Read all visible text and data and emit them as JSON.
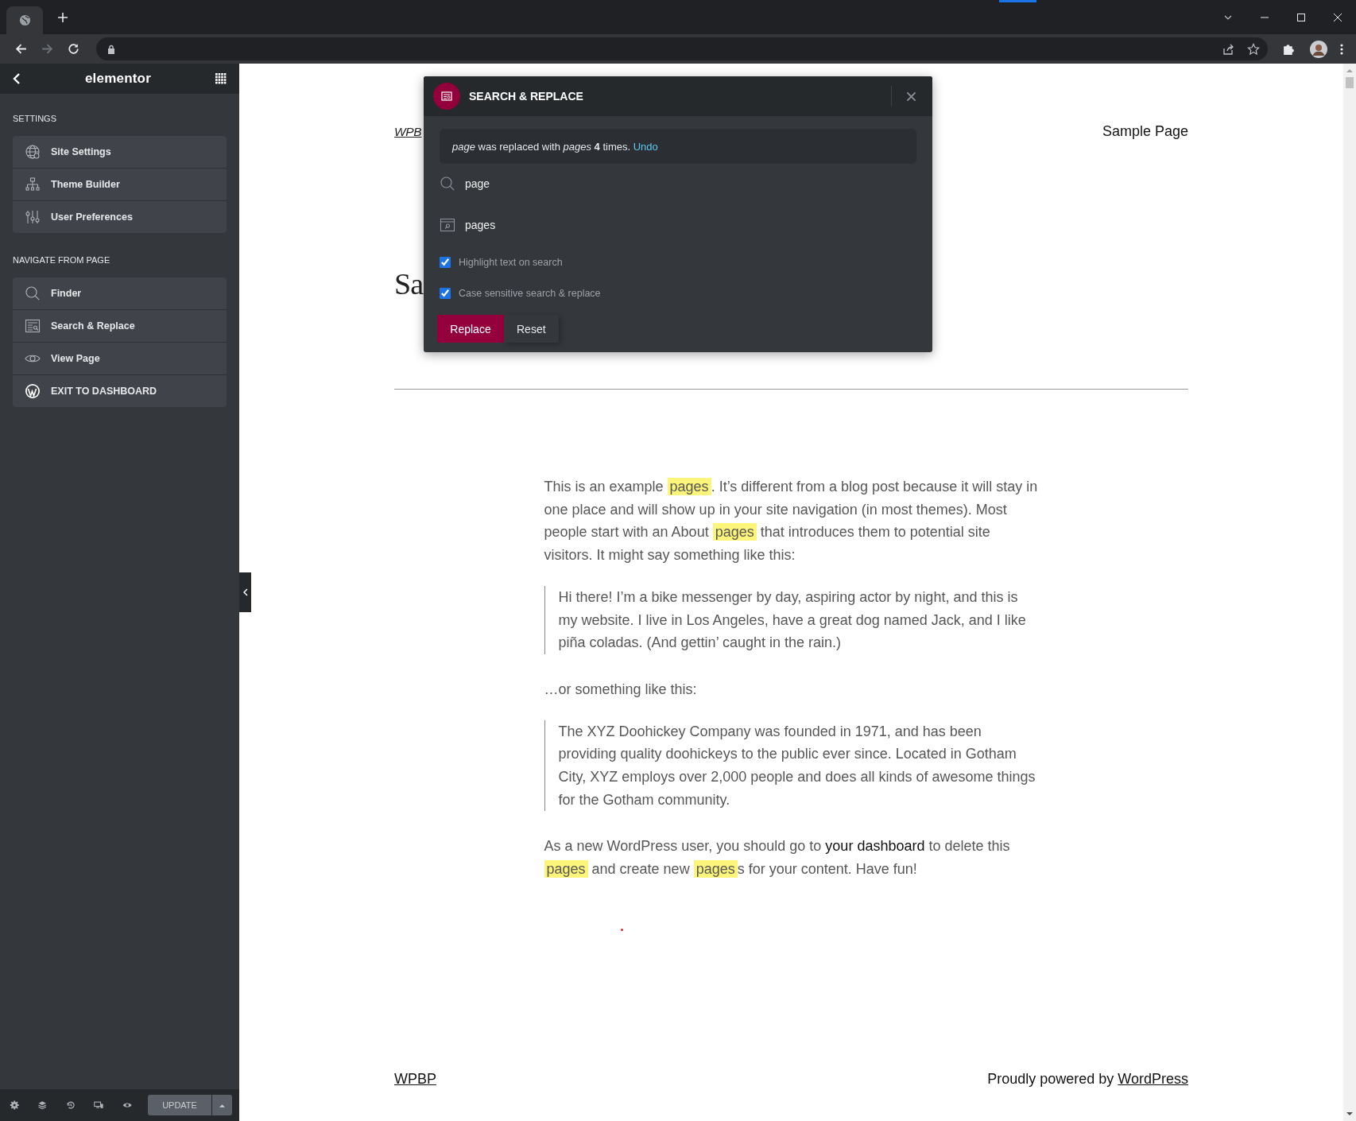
{
  "browser": {
    "forward_disabled": true
  },
  "sidebar": {
    "brand": "elementor",
    "sections": [
      {
        "heading": "SETTINGS",
        "items": [
          {
            "label": "Site Settings",
            "kind": "globe"
          },
          {
            "label": "Theme Builder",
            "kind": "sitemap"
          },
          {
            "label": "User Preferences",
            "kind": "sliders"
          }
        ]
      },
      {
        "heading": "NAVIGATE FROM PAGE",
        "items": [
          {
            "label": "Finder",
            "kind": "search"
          },
          {
            "label": "Search & Replace",
            "kind": "document"
          },
          {
            "label": "View Page",
            "kind": "eye"
          },
          {
            "label": "EXIT TO DASHBOARD",
            "kind": "wordpress"
          }
        ]
      }
    ],
    "toolbar": {
      "update_label": "UPDATE"
    }
  },
  "page": {
    "site_title": "WPB",
    "nav_link": "Sample Page",
    "title": "Sa",
    "content": [
      {
        "kind": "paragraph",
        "segments": [
          {
            "kind": "text",
            "text": "This is an example "
          },
          {
            "kind": "highlight",
            "text": "pages"
          },
          {
            "kind": "text",
            "text": ". It’s different from a blog post because it will stay in one place and will show up in your site navigation (in most themes). Most people start with an About "
          },
          {
            "kind": "highlight",
            "text": "pages"
          },
          {
            "kind": "text",
            "text": " that introduces them to potential site visitors. It might say something like this:"
          }
        ]
      },
      {
        "kind": "quote",
        "segments": [
          {
            "kind": "text",
            "text": "Hi there! I’m a bike messenger by day, aspiring actor by night, and this is my website. I live in Los Angeles, have a great dog named Jack, and I like piña coladas. (And gettin’ caught in the rain.)"
          }
        ]
      },
      {
        "kind": "paragraph",
        "segments": [
          {
            "kind": "text",
            "text": "…or something like this:"
          }
        ]
      },
      {
        "kind": "quote",
        "segments": [
          {
            "kind": "text",
            "text": "The XYZ Doohickey Company was founded in 1971, and has been providing quality doohickeys to the public ever since. Located in Gotham City, XYZ employs over 2,000 people and does all kinds of awesome things for the Gotham community."
          }
        ]
      },
      {
        "kind": "paragraph",
        "segments": [
          {
            "kind": "text",
            "text": "As a new WordPress user, you should go to "
          },
          {
            "kind": "link",
            "text": "your dashboard"
          },
          {
            "kind": "text",
            "text": " to delete this "
          },
          {
            "kind": "highlight",
            "text": "pages"
          },
          {
            "kind": "text",
            "text": " and create new "
          },
          {
            "kind": "highlight",
            "text": "pages"
          },
          {
            "kind": "text",
            "text": "s for your content. Have fun!"
          }
        ]
      }
    ],
    "footer": {
      "site": "WPBP",
      "credit": "Proudly powered by ",
      "credit_link": "WordPress"
    }
  },
  "dialog": {
    "title": "SEARCH & REPLACE",
    "notice": "*page* was replaced with *pages* **4** times.",
    "notice_link": "Undo",
    "search_value": "page",
    "replace_value": "pages",
    "options": [
      {
        "label": "Highlight text on search",
        "checked": true
      },
      {
        "label": "Case sensitive search & replace",
        "checked": true
      }
    ],
    "buttons": [
      {
        "label": "Replace",
        "kind": "primary"
      },
      {
        "label": "Reset",
        "kind": "secondary"
      }
    ]
  }
}
